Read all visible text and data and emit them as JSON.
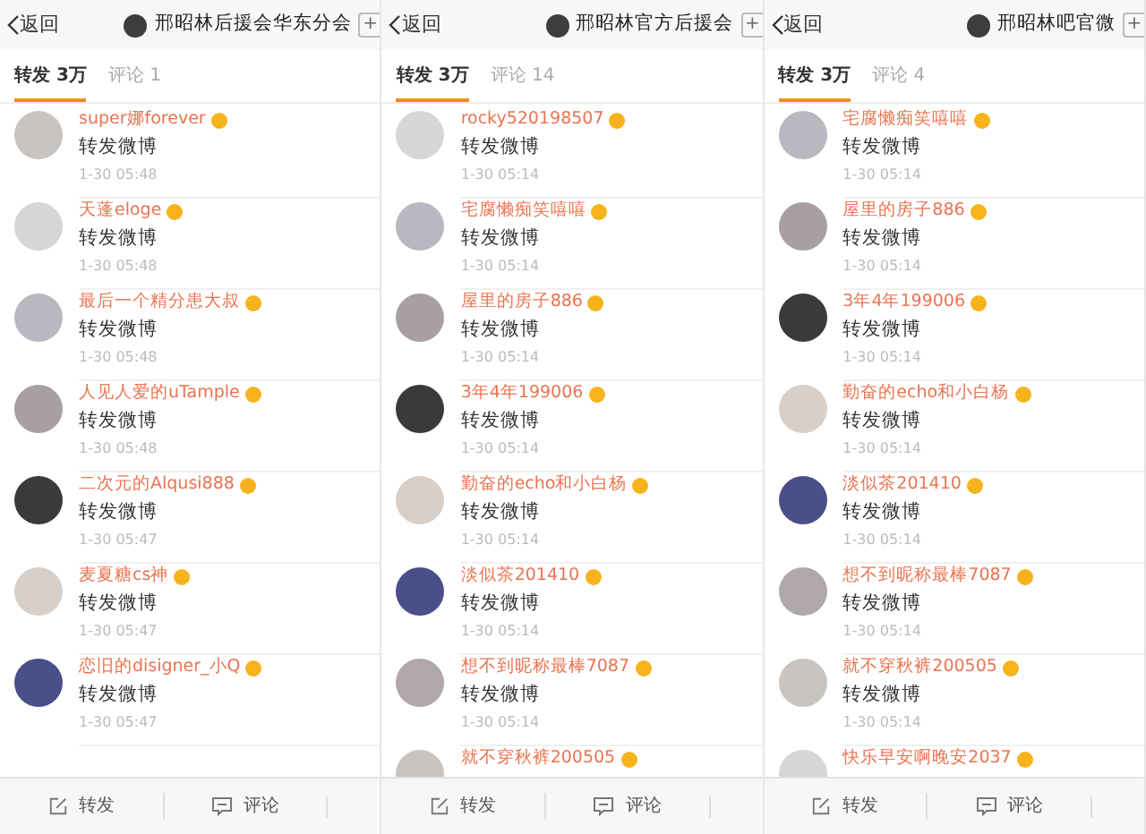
{
  "panels": [
    {
      "back": "返回",
      "title": "邢昭林后援会华东分会",
      "add": "+",
      "tabs": [
        {
          "label": "转发 3万",
          "selected": true
        },
        {
          "label": "评论 1",
          "selected": false
        }
      ],
      "rows": [
        {
          "name": "super娜forever",
          "text": "转发微博",
          "time": "1-30 05:48"
        },
        {
          "name": "天蓬eloge",
          "text": "转发微博",
          "time": "1-30 05:48"
        },
        {
          "name": "最后一个精分患大叔",
          "text": "转发微博",
          "time": "1-30 05:48"
        },
        {
          "name": "人见人爱的uTample",
          "text": "转发微博",
          "time": "1-30 05:48"
        },
        {
          "name": "二次元的Alqusi888",
          "text": "转发微博",
          "time": "1-30 05:47"
        },
        {
          "name": "麦夏糖cs神",
          "text": "转发微博",
          "time": "1-30 05:47"
        },
        {
          "name": "恋旧的disigner_小Q",
          "text": "转发微博",
          "time": "1-30 05:47"
        }
      ],
      "bottom": [
        {
          "label": "转发",
          "kind": "repost"
        },
        {
          "label": "评论",
          "kind": "comment"
        }
      ]
    },
    {
      "back": "返回",
      "title": "邢昭林官方后援会",
      "add": "+",
      "tabs": [
        {
          "label": "转发 3万",
          "selected": true
        },
        {
          "label": "评论 14",
          "selected": false
        }
      ],
      "rows": [
        {
          "name": "rocky520198507",
          "text": "转发微博",
          "time": "1-30 05:14"
        },
        {
          "name": "宅腐懒痴笑嘻嘻",
          "text": "转发微博",
          "time": "1-30 05:14"
        },
        {
          "name": "屋里的房子886",
          "text": "转发微博",
          "time": "1-30 05:14"
        },
        {
          "name": "3年4年199006",
          "text": "转发微博",
          "time": "1-30 05:14"
        },
        {
          "name": "勤奋的echo和小白杨",
          "text": "转发微博",
          "time": "1-30 05:14"
        },
        {
          "name": "淡似茶201410",
          "text": "转发微博",
          "time": "1-30 05:14"
        },
        {
          "name": "想不到昵称最棒7087",
          "text": "转发微博",
          "time": "1-30 05:14"
        },
        {
          "name": "就不穿秋裤200505"
        }
      ],
      "bottom": [
        {
          "label": "转发",
          "kind": "repost"
        },
        {
          "label": "评论",
          "kind": "comment"
        }
      ]
    },
    {
      "back": "返回",
      "title": "邢昭林吧官微",
      "add": "+",
      "tabs": [
        {
          "label": "转发 3万",
          "selected": true
        },
        {
          "label": "评论 4",
          "selected": false
        }
      ],
      "rows": [
        {
          "name": "宅腐懒痴笑嘻嘻",
          "text": "转发微博",
          "time": "1-30 05:14"
        },
        {
          "name": "屋里的房子886",
          "text": "转发微博",
          "time": "1-30 05:14"
        },
        {
          "name": "3年4年199006",
          "text": "转发微博",
          "time": "1-30 05:14"
        },
        {
          "name": "勤奋的echo和小白杨",
          "text": "转发微博",
          "time": "1-30 05:14"
        },
        {
          "name": "淡似茶201410",
          "text": "转发微博",
          "time": "1-30 05:14"
        },
        {
          "name": "想不到昵称最棒7087",
          "text": "转发微博",
          "time": "1-30 05:14"
        },
        {
          "name": "就不穿秋裤200505",
          "text": "转发微博",
          "time": "1-30 05:14"
        },
        {
          "name": "快乐早安啊晚安2037"
        }
      ],
      "bottom": [
        {
          "label": "转发",
          "kind": "repost"
        },
        {
          "label": "评论",
          "kind": "comment"
        }
      ]
    }
  ]
}
